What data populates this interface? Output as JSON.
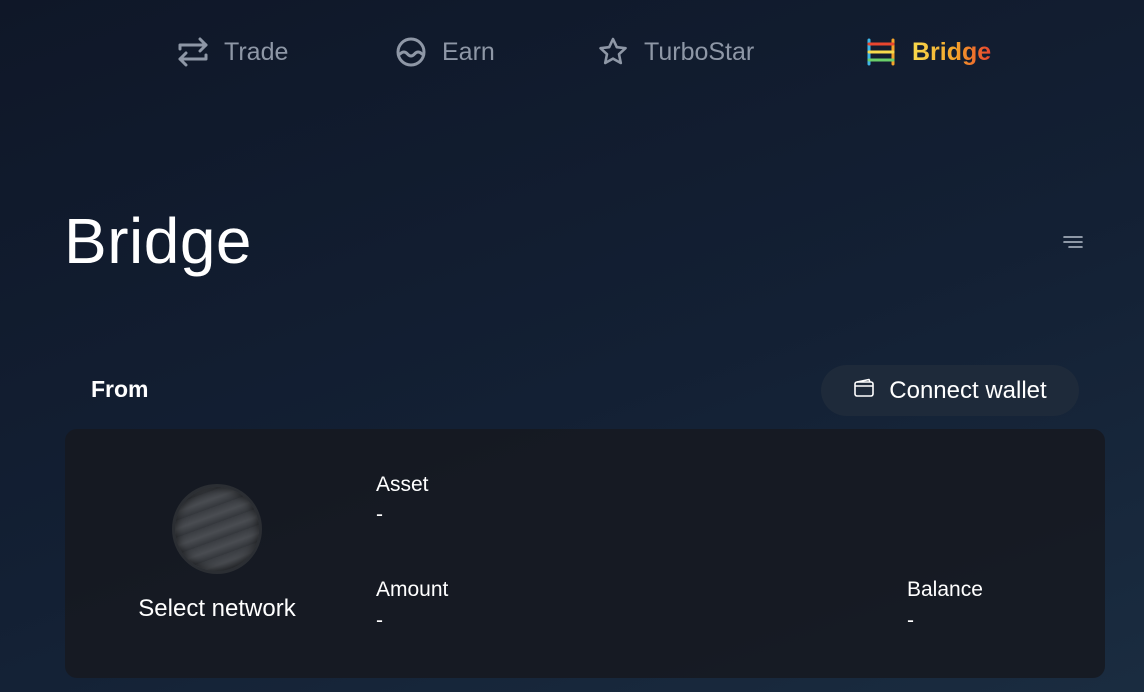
{
  "nav": {
    "items": [
      {
        "label": "Trade",
        "icon": "swap-arrows-icon"
      },
      {
        "label": "Earn",
        "icon": "wave-circle-icon"
      },
      {
        "label": "TurboStar",
        "icon": "star-icon"
      },
      {
        "label": "Bridge",
        "icon": "bridge-icon",
        "active": true
      }
    ]
  },
  "page": {
    "title": "Bridge",
    "menu_icon": "filter-lines-icon"
  },
  "from": {
    "label": "From",
    "connect_wallet_label": "Connect wallet",
    "connect_wallet_icon": "wallet-icon",
    "network_label": "Select network",
    "asset_label": "Asset",
    "asset_value": "-",
    "amount_label": "Amount",
    "amount_value": "-",
    "balance_label": "Balance",
    "balance_value": "-"
  },
  "colors": {
    "active_gradient": [
      "#f7d94c",
      "#f4a32a",
      "#e9452e"
    ],
    "nav_inactive": "#8e97a6",
    "button_bg": "#1e2a3a"
  }
}
